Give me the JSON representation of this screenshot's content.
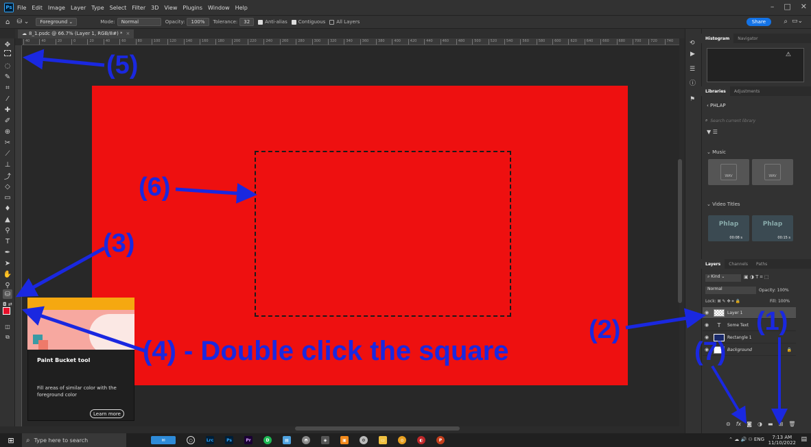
{
  "menubar": {
    "logo": "Ps",
    "items": [
      "File",
      "Edit",
      "Image",
      "Layer",
      "Type",
      "Select",
      "Filter",
      "3D",
      "View",
      "Plugins",
      "Window",
      "Help"
    ]
  },
  "options": {
    "fill_source": "Foreground",
    "mode_label": "Mode:",
    "mode_value": "Normal",
    "opacity_label": "Opacity:",
    "opacity_value": "100%",
    "tolerance_label": "Tolerance:",
    "tolerance_value": "32",
    "antialias_label": "Anti-alias",
    "contiguous_label": "Contiguous",
    "all_layers_label": "All Layers",
    "share_label": "Share"
  },
  "document": {
    "tab_title": "8_1.psdc @ 66.7% (Layer 1, RGB/8#) *",
    "ruler_ticks": [
      "40",
      "40",
      "20",
      "0",
      "20",
      "40",
      "60",
      "80",
      "100",
      "120",
      "140",
      "160",
      "180",
      "200",
      "220",
      "240",
      "260",
      "280",
      "300",
      "320",
      "340",
      "360",
      "380",
      "400",
      "420",
      "440",
      "460",
      "480",
      "500",
      "520",
      "540",
      "560",
      "580",
      "600",
      "620",
      "640",
      "660",
      "680",
      "700",
      "720",
      "740"
    ]
  },
  "tooltip": {
    "title": "Paint Bucket tool",
    "description": "Fill areas of similar color with the foreground color",
    "learn_more": "Learn more"
  },
  "panels": {
    "histogram_tab": "Histogram",
    "navigator_tab": "Navigator",
    "libraries_tab": "Libraries",
    "adjustments_tab": "Adjustments",
    "library_name": "PHLAP",
    "search_placeholder": "Search current library",
    "music_label": "Music",
    "wav_label": "WAV",
    "video_titles_label": "Video Titles",
    "video_thumb_label": "Phlap",
    "video_durations": [
      "00:08 s",
      "00:15 s"
    ],
    "layers_tab": "Layers",
    "channels_tab": "Channels",
    "paths_tab": "Paths",
    "kind_label": "Kind",
    "blend_mode": "Normal",
    "opacity_label": "Opacity:",
    "opacity_value": "100%",
    "lock_label": "Lock:",
    "fill_label": "Fill:",
    "fill_value": "100%",
    "layers": [
      "Layer 1",
      "Some Text",
      "Rectangle 1",
      "Background"
    ]
  },
  "taskbar": {
    "search_placeholder": "Type here to search",
    "language": "ENG",
    "time": "7:13 AM",
    "date": "11/10/2022",
    "apps": [
      "Lrc",
      "Ps",
      "Pr"
    ]
  },
  "annotations": {
    "a1": "(1)",
    "a2": "(2)",
    "a3": "(3)",
    "a4": "(4) - Double click the square",
    "a5": "(5)",
    "a6": "(6)",
    "a7": "(7)"
  },
  "colors": {
    "canvas_red": "#ee1010",
    "foreground_swatch": "#e8102a",
    "annotation_blue": "#1a28e0",
    "accent_blue": "#1473e6"
  }
}
